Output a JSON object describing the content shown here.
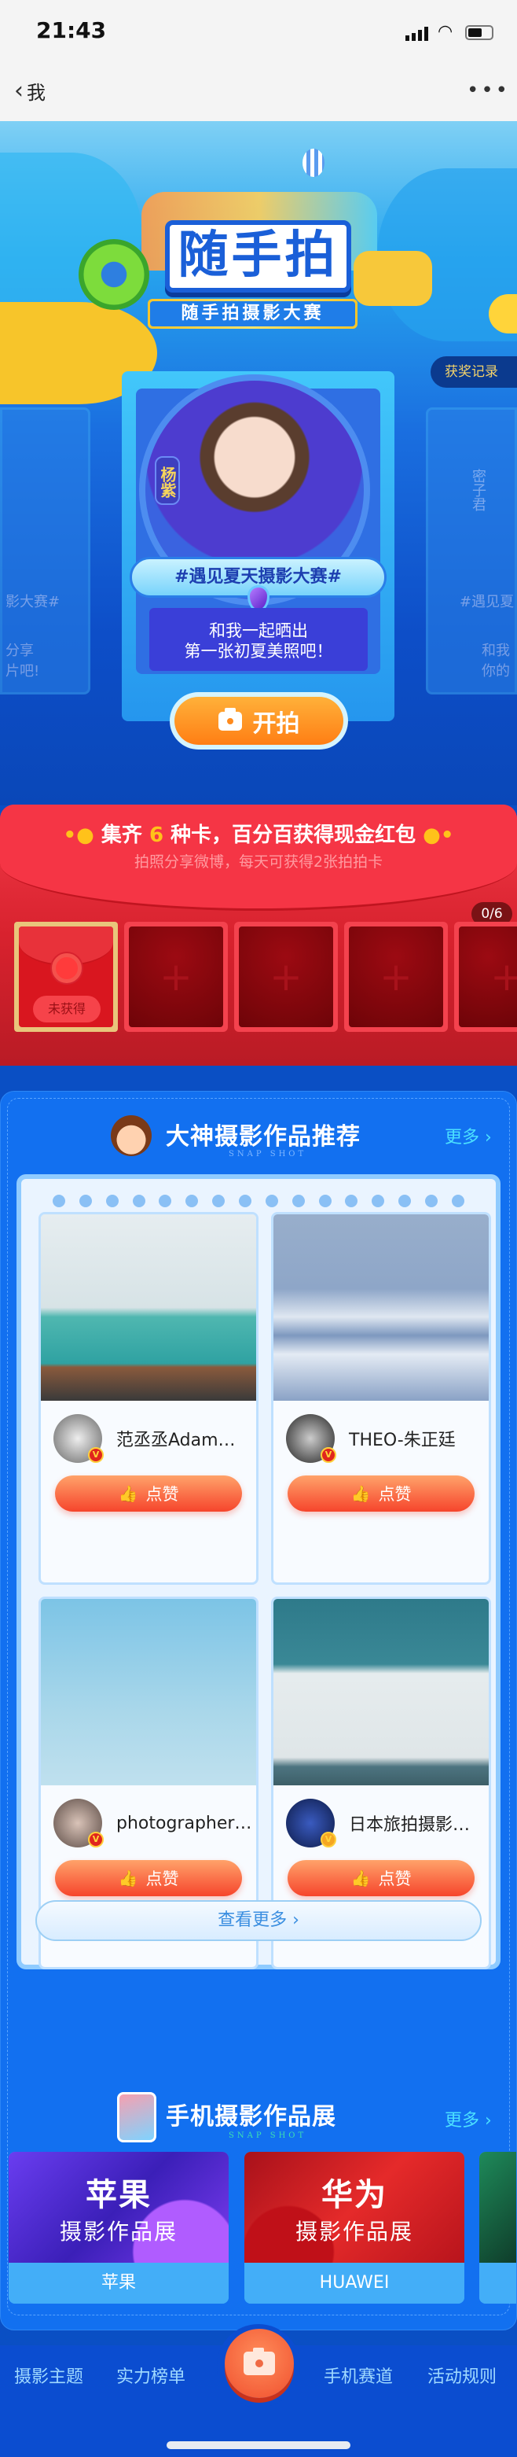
{
  "status_bar": {
    "time": "21:43"
  },
  "nav": {
    "back_label": "我",
    "more_icon": "ellipsis-icon"
  },
  "banner": {
    "logo_text": "随手拍",
    "subtitle": "随手拍摄影大赛",
    "award_record": "获奖记录",
    "center_card": {
      "name": "杨紫",
      "hashtag": "#遇见夏天摄影大赛#",
      "message_line1": "和我一起晒出",
      "message_line2": "第一张初夏美照吧！"
    },
    "left_card": {
      "hashtag": "影大赛#",
      "line1": "分享",
      "line2": "片吧!"
    },
    "right_card": {
      "name": "密子君",
      "hashtag": "#遇见夏",
      "line1": "和我",
      "line2": "你的"
    },
    "shoot_button": "开拍"
  },
  "cards": {
    "title_prefix": "集齐",
    "title_number": "6",
    "title_suffix": "种卡，百分百获得现金红包",
    "subtitle": "拍照分享微博，每天可获得2张拍拍卡",
    "progress": "0/6",
    "collected": 0,
    "total": 6,
    "first_card_status": "未获得",
    "empty_slot_symbol": "+"
  },
  "recommend": {
    "title": "大神摄影作品推荐",
    "tagline": "SNAP SHOT",
    "more": "更多 ›",
    "like_label": "点赞",
    "view_more": "查看更多 ›",
    "works": [
      {
        "author": "范丞丞Adam…"
      },
      {
        "author": "THEO-朱正廷"
      },
      {
        "author": "photographer…"
      },
      {
        "author": "日本旅拍摄影…"
      }
    ]
  },
  "phone_gallery": {
    "title": "手机摄影作品展",
    "tagline": "SNAP SHOT",
    "more": "更多 ›",
    "brands": [
      {
        "big": "苹果",
        "small": "摄影作品展",
        "label": "苹果"
      },
      {
        "big": "华为",
        "small": "摄影作品展",
        "label": "HUAWEI"
      }
    ]
  },
  "bottom_nav": {
    "items": [
      "摄影主题",
      "实力榜单",
      "手机赛道",
      "活动规则"
    ],
    "center_icon": "camera-icon"
  },
  "colors": {
    "primary_blue": "#1270f0",
    "red": "#f23a48",
    "orange": "#ff7e14",
    "accent_cyan": "#4be0ff"
  }
}
